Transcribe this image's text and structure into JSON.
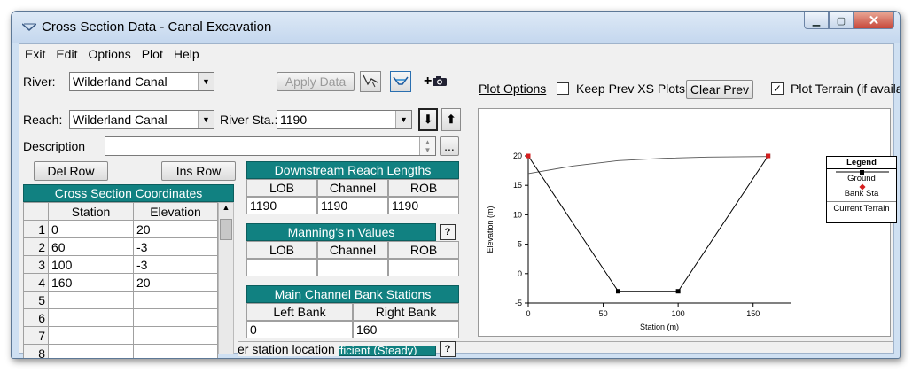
{
  "window": {
    "title": "Cross Section Data - Canal Excavation",
    "controls": {
      "minimize": "▁",
      "maximize": "▢",
      "close": "✕"
    }
  },
  "menu": [
    "Exit",
    "Edit",
    "Options",
    "Plot",
    "Help"
  ],
  "river": {
    "label": "River:",
    "value": "Wilderland Canal"
  },
  "reach": {
    "label": "Reach:",
    "value": "Wilderland Canal"
  },
  "river_sta": {
    "label": "River Sta.:",
    "value": "1190"
  },
  "apply_data": "Apply Data",
  "description": {
    "label": "Description",
    "value": "",
    "more": "..."
  },
  "del_row": "Del Row",
  "ins_row": "Ins Row",
  "xs_coords": {
    "title": "Cross Section Coordinates",
    "headers": [
      "Station",
      "Elevation"
    ],
    "rows": [
      {
        "n": "1",
        "station": "0",
        "elev": "20"
      },
      {
        "n": "2",
        "station": "60",
        "elev": "-3"
      },
      {
        "n": "3",
        "station": "100",
        "elev": "-3"
      },
      {
        "n": "4",
        "station": "160",
        "elev": "20"
      },
      {
        "n": "5",
        "station": "",
        "elev": ""
      },
      {
        "n": "6",
        "station": "",
        "elev": ""
      },
      {
        "n": "7",
        "station": "",
        "elev": ""
      },
      {
        "n": "8",
        "station": "",
        "elev": ""
      }
    ]
  },
  "reach_lengths": {
    "title": "Downstream Reach Lengths",
    "headers": [
      "LOB",
      "Channel",
      "ROB"
    ],
    "values": [
      "1190",
      "1190",
      "1190"
    ]
  },
  "mannings": {
    "title": "Manning's n Values",
    "headers": [
      "LOB",
      "Channel",
      "ROB"
    ],
    "values": [
      "",
      "",
      ""
    ],
    "help": "?"
  },
  "bank_stations": {
    "title": "Main Channel Bank Stations",
    "headers": [
      "Left Bank",
      "Right Bank"
    ],
    "values": [
      "0",
      "160"
    ]
  },
  "contraction_partial": "Cont\\Exp Coefficient (Steady)",
  "status_text": "er station location",
  "status_help": "?",
  "plot_options": {
    "link": "Plot Options",
    "keep_prev_label": "Keep Prev XS Plots",
    "keep_prev_checked": false,
    "clear_prev": "Clear Prev",
    "plot_terrain_label": "Plot Terrain (if availab",
    "plot_terrain_checked": true
  },
  "chart_data": {
    "type": "line",
    "xlabel": "Station (m)",
    "ylabel": "Elevation (m)",
    "xlim": [
      0,
      175
    ],
    "ylim": [
      -5,
      20
    ],
    "xticks": [
      0,
      50,
      100,
      150
    ],
    "yticks": [
      -5,
      0,
      5,
      10,
      15,
      20
    ],
    "series": [
      {
        "name": "Ground",
        "x": [
          0,
          60,
          100,
          160
        ],
        "y": [
          20,
          -3,
          -3,
          20
        ],
        "color": "#000000"
      },
      {
        "name": "Current Terrain",
        "x": [
          0,
          30,
          60,
          90,
          120,
          160
        ],
        "y": [
          17,
          18.3,
          19.2,
          19.6,
          19.8,
          19.9
        ],
        "color": "#555555"
      }
    ],
    "bank_stations": {
      "name": "Bank Sta",
      "x": [
        0,
        160
      ],
      "y": [
        20,
        20
      ],
      "color": "#d61f1f"
    },
    "legend": {
      "title": "Legend",
      "entries": [
        "Ground",
        "Bank Sta",
        "Current Terrain"
      ],
      "position": "right"
    }
  }
}
